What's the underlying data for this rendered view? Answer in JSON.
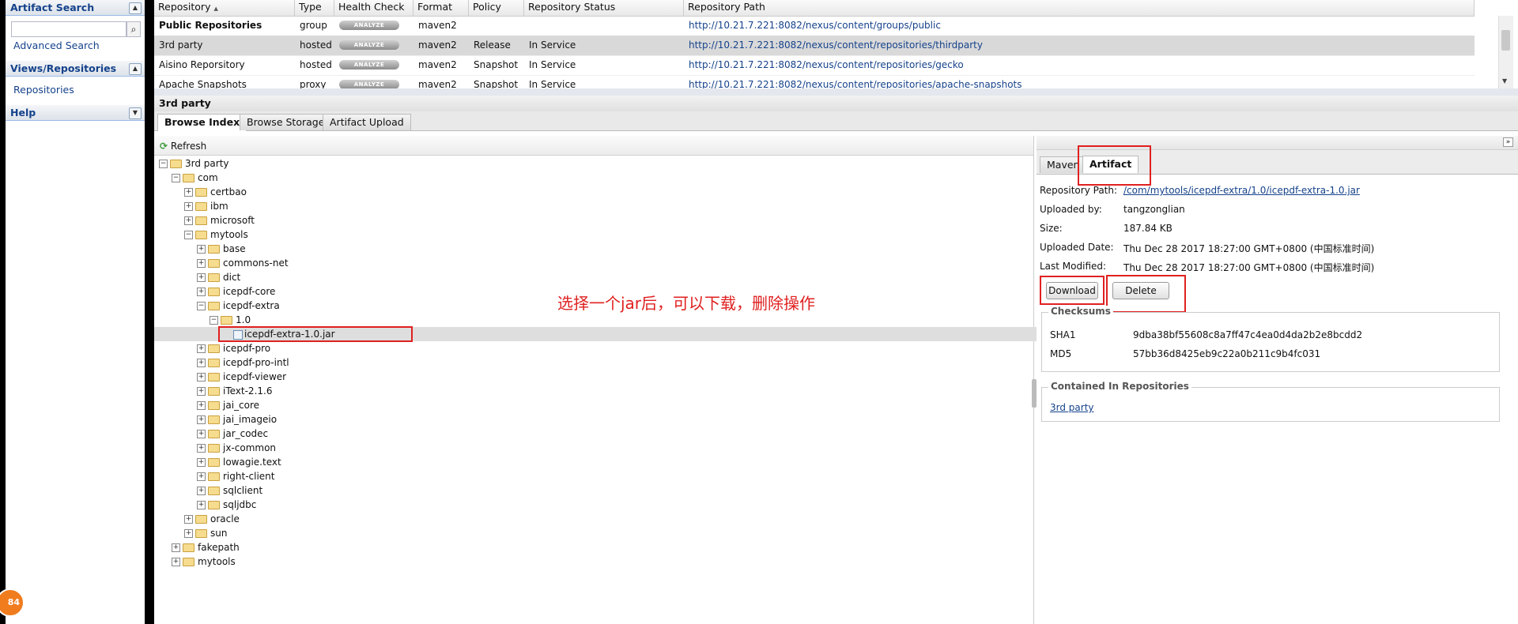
{
  "left_panel": {
    "artifact_search": {
      "title": "Artifact Search",
      "search_value": "",
      "advanced_link": "Advanced Search"
    },
    "views": {
      "title": "Views/Repositories",
      "repositories_link": "Repositories"
    },
    "help": {
      "title": "Help"
    },
    "badge": "84"
  },
  "grid": {
    "columns": [
      "Repository",
      "Type",
      "Health Check",
      "Format",
      "Policy",
      "Repository Status",
      "Repository Path"
    ],
    "sort_indicator": "▲",
    "rows": [
      {
        "name": "Public Repositories",
        "type": "group",
        "health": "ANALYZE",
        "format": "maven2",
        "policy": "",
        "status": "",
        "path": "http://10.21.7.221:8082/nexus/content/groups/public"
      },
      {
        "name": "3rd party",
        "type": "hosted",
        "health": "ANALYZE",
        "format": "maven2",
        "policy": "Release",
        "status": "In Service",
        "path": "http://10.21.7.221:8082/nexus/content/repositories/thirdparty"
      },
      {
        "name": "Aisino Reporsitory",
        "type": "hosted",
        "health": "ANALYZE",
        "format": "maven2",
        "policy": "Snapshot",
        "status": "In Service",
        "path": "http://10.21.7.221:8082/nexus/content/repositories/gecko"
      },
      {
        "name": "Apache Snapshots",
        "type": "proxy",
        "health": "ANALYZE",
        "format": "maven2",
        "policy": "Snapshot",
        "status": "In Service",
        "path": "http://10.21.7.221:8082/nexus/content/repositories/apache-snapshots"
      }
    ]
  },
  "detail": {
    "title": "3rd party",
    "tabs": [
      "Browse Index",
      "Browse Storage",
      "Artifact Upload"
    ],
    "refresh_label": "Refresh"
  },
  "tree": {
    "nodes": [
      {
        "label": "3rd party",
        "toggle": "−",
        "kind": "folder"
      },
      {
        "label": "com",
        "toggle": "−",
        "kind": "folder"
      },
      {
        "label": "certbao",
        "toggle": "+",
        "kind": "folder"
      },
      {
        "label": "ibm",
        "toggle": "+",
        "kind": "folder"
      },
      {
        "label": "microsoft",
        "toggle": "+",
        "kind": "folder"
      },
      {
        "label": "mytools",
        "toggle": "−",
        "kind": "folder"
      },
      {
        "label": "base",
        "toggle": "+",
        "kind": "folder"
      },
      {
        "label": "commons-net",
        "toggle": "+",
        "kind": "folder"
      },
      {
        "label": "dict",
        "toggle": "+",
        "kind": "folder"
      },
      {
        "label": "icepdf-core",
        "toggle": "+",
        "kind": "folder"
      },
      {
        "label": "icepdf-extra",
        "toggle": "−",
        "kind": "folder"
      },
      {
        "label": "1.0",
        "toggle": "−",
        "kind": "folder"
      },
      {
        "label": "icepdf-extra-1.0.jar",
        "toggle": "",
        "kind": "file"
      },
      {
        "label": "icepdf-pro",
        "toggle": "+",
        "kind": "folder"
      },
      {
        "label": "icepdf-pro-intl",
        "toggle": "+",
        "kind": "folder"
      },
      {
        "label": "icepdf-viewer",
        "toggle": "+",
        "kind": "folder"
      },
      {
        "label": "iText-2.1.6",
        "toggle": "+",
        "kind": "folder"
      },
      {
        "label": "jai_core",
        "toggle": "+",
        "kind": "folder"
      },
      {
        "label": "jai_imageio",
        "toggle": "+",
        "kind": "folder"
      },
      {
        "label": "jar_codec",
        "toggle": "+",
        "kind": "folder"
      },
      {
        "label": "jx-common",
        "toggle": "+",
        "kind": "folder"
      },
      {
        "label": "lowagie.text",
        "toggle": "+",
        "kind": "folder"
      },
      {
        "label": "right-client",
        "toggle": "+",
        "kind": "folder"
      },
      {
        "label": "sqlclient",
        "toggle": "+",
        "kind": "folder"
      },
      {
        "label": "sqljdbc",
        "toggle": "+",
        "kind": "folder"
      },
      {
        "label": "oracle",
        "toggle": "+",
        "kind": "folder"
      },
      {
        "label": "sun",
        "toggle": "+",
        "kind": "folder"
      },
      {
        "label": "fakepath",
        "toggle": "+",
        "kind": "folder"
      },
      {
        "label": "mytools",
        "toggle": "+",
        "kind": "folder"
      }
    ]
  },
  "annotation": "选择一个jar后，可以下载，删除操作",
  "artifact": {
    "tabs": [
      "Maven",
      "Artifact"
    ],
    "fields": [
      {
        "label": "Repository Path:",
        "value": "/com/mytools/icepdf-extra/1.0/icepdf-extra-1.0.jar"
      },
      {
        "label": "Uploaded by:",
        "value": "tangzonglian"
      },
      {
        "label": "Size:",
        "value": "187.84 KB"
      },
      {
        "label": "Uploaded Date:",
        "value": "Thu Dec 28 2017 18:27:00 GMT+0800 (中国标准时间)"
      },
      {
        "label": "Last Modified:",
        "value": "Thu Dec 28 2017 18:27:00 GMT+0800 (中国标准时间)"
      }
    ],
    "download_label": "Download",
    "delete_label": "Delete",
    "checksums_title": "Checksums",
    "sha1_label": "SHA1",
    "sha1_value": "9dba38bf55608c8a7ff47c4ea0d4da2b2e8bcdd2",
    "md5_label": "MD5",
    "md5_value": "57bb36d8425eb9c22a0b211c9b4fc031",
    "contained_title": "Contained In Repositories",
    "contained_link": "3rd party",
    "expand_glyph": "»"
  },
  "colors": {
    "accent_link": "#15428b",
    "annotation_red": "#e02020",
    "selected_row": "#d9d9d9"
  }
}
